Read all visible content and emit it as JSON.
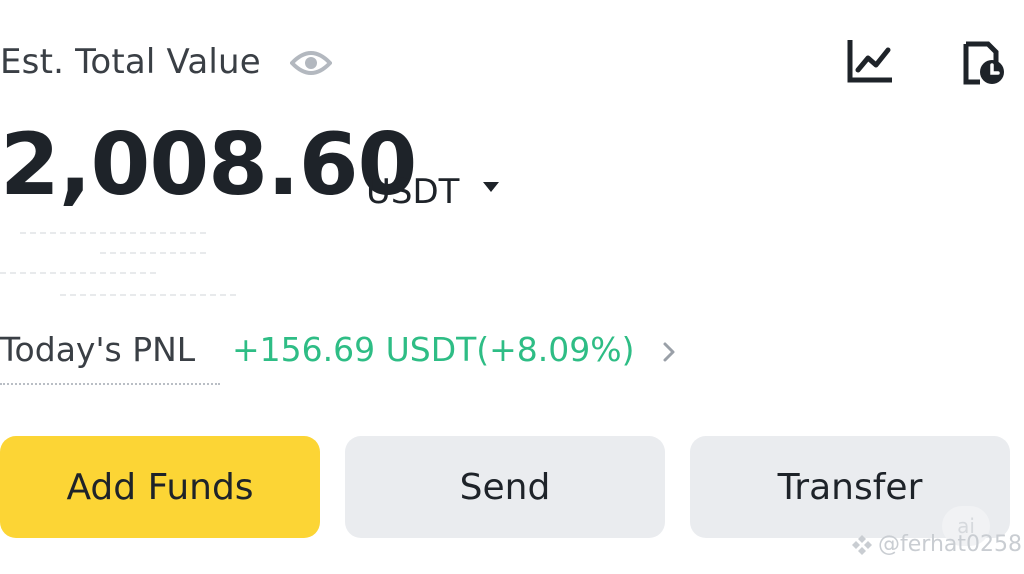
{
  "header": {
    "est_label": "Est. Total Value",
    "eye_icon": "eye-icon",
    "chart_icon": "line-chart-icon",
    "history_icon": "order-history-icon"
  },
  "balance": {
    "amount": "2,008.60",
    "currency": "USDT"
  },
  "pnl": {
    "label": "Today's PNL",
    "value": "+156.69 USDT(+8.09%)",
    "color": "#2ebd85"
  },
  "actions": {
    "add_funds": "Add Funds",
    "send": "Send",
    "transfer": "Transfer"
  },
  "colors": {
    "accent": "#fcd535",
    "button_bg": "#eaecef",
    "text": "#1e2329"
  },
  "watermark": {
    "text": "@ferhat0258",
    "badge": "ai"
  }
}
